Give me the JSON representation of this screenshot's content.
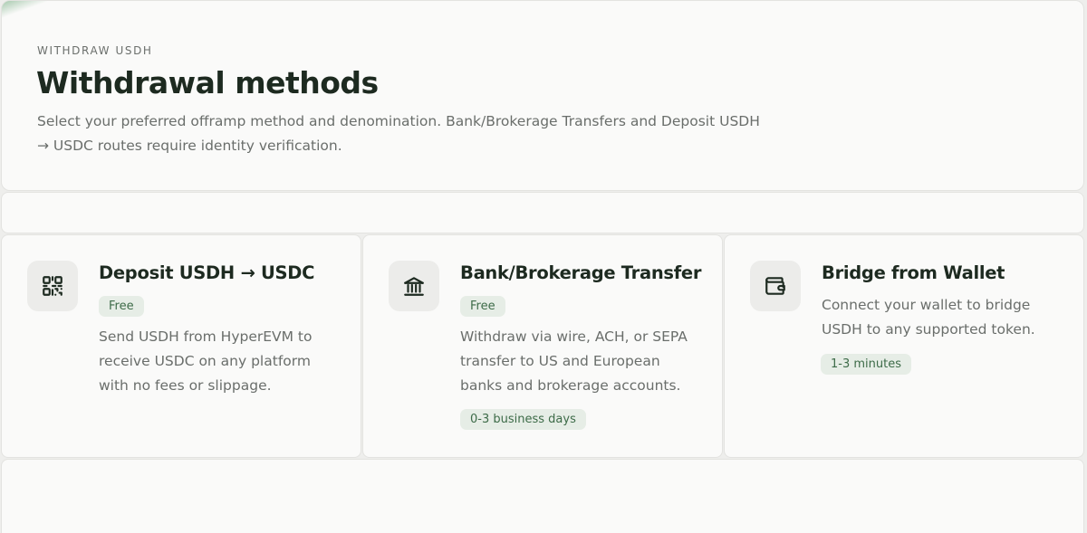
{
  "header": {
    "eyebrow": "WITHDRAW USDH",
    "title": "Withdrawal methods",
    "subtitle": "Select your preferred offramp method and denomination. Bank/Brokerage Transfers and Deposit USDH → USDC routes require identity verification."
  },
  "methods": [
    {
      "icon": "qr-code-icon",
      "title": "Deposit USDH → USDC",
      "fee": "Free",
      "description": "Send USDH from HyperEVM to receive USDC on any platform with no fees or slippage."
    },
    {
      "icon": "bank-icon",
      "title": "Bank/Brokerage Transfer",
      "fee": "Free",
      "description": "Withdraw via wire, ACH, or SEPA transfer to US and European banks and brokerage accounts.",
      "time": "0-3 business days"
    },
    {
      "icon": "wallet-icon",
      "title": "Bridge from Wallet",
      "description": "Connect your wallet to bridge USDH to any supported token.",
      "time": "1-3 minutes"
    }
  ],
  "colors": {
    "accent": "#3d6b48",
    "badge_bg": "#e6ede6",
    "heading": "#1d2a20",
    "muted": "#6a6e6b"
  }
}
